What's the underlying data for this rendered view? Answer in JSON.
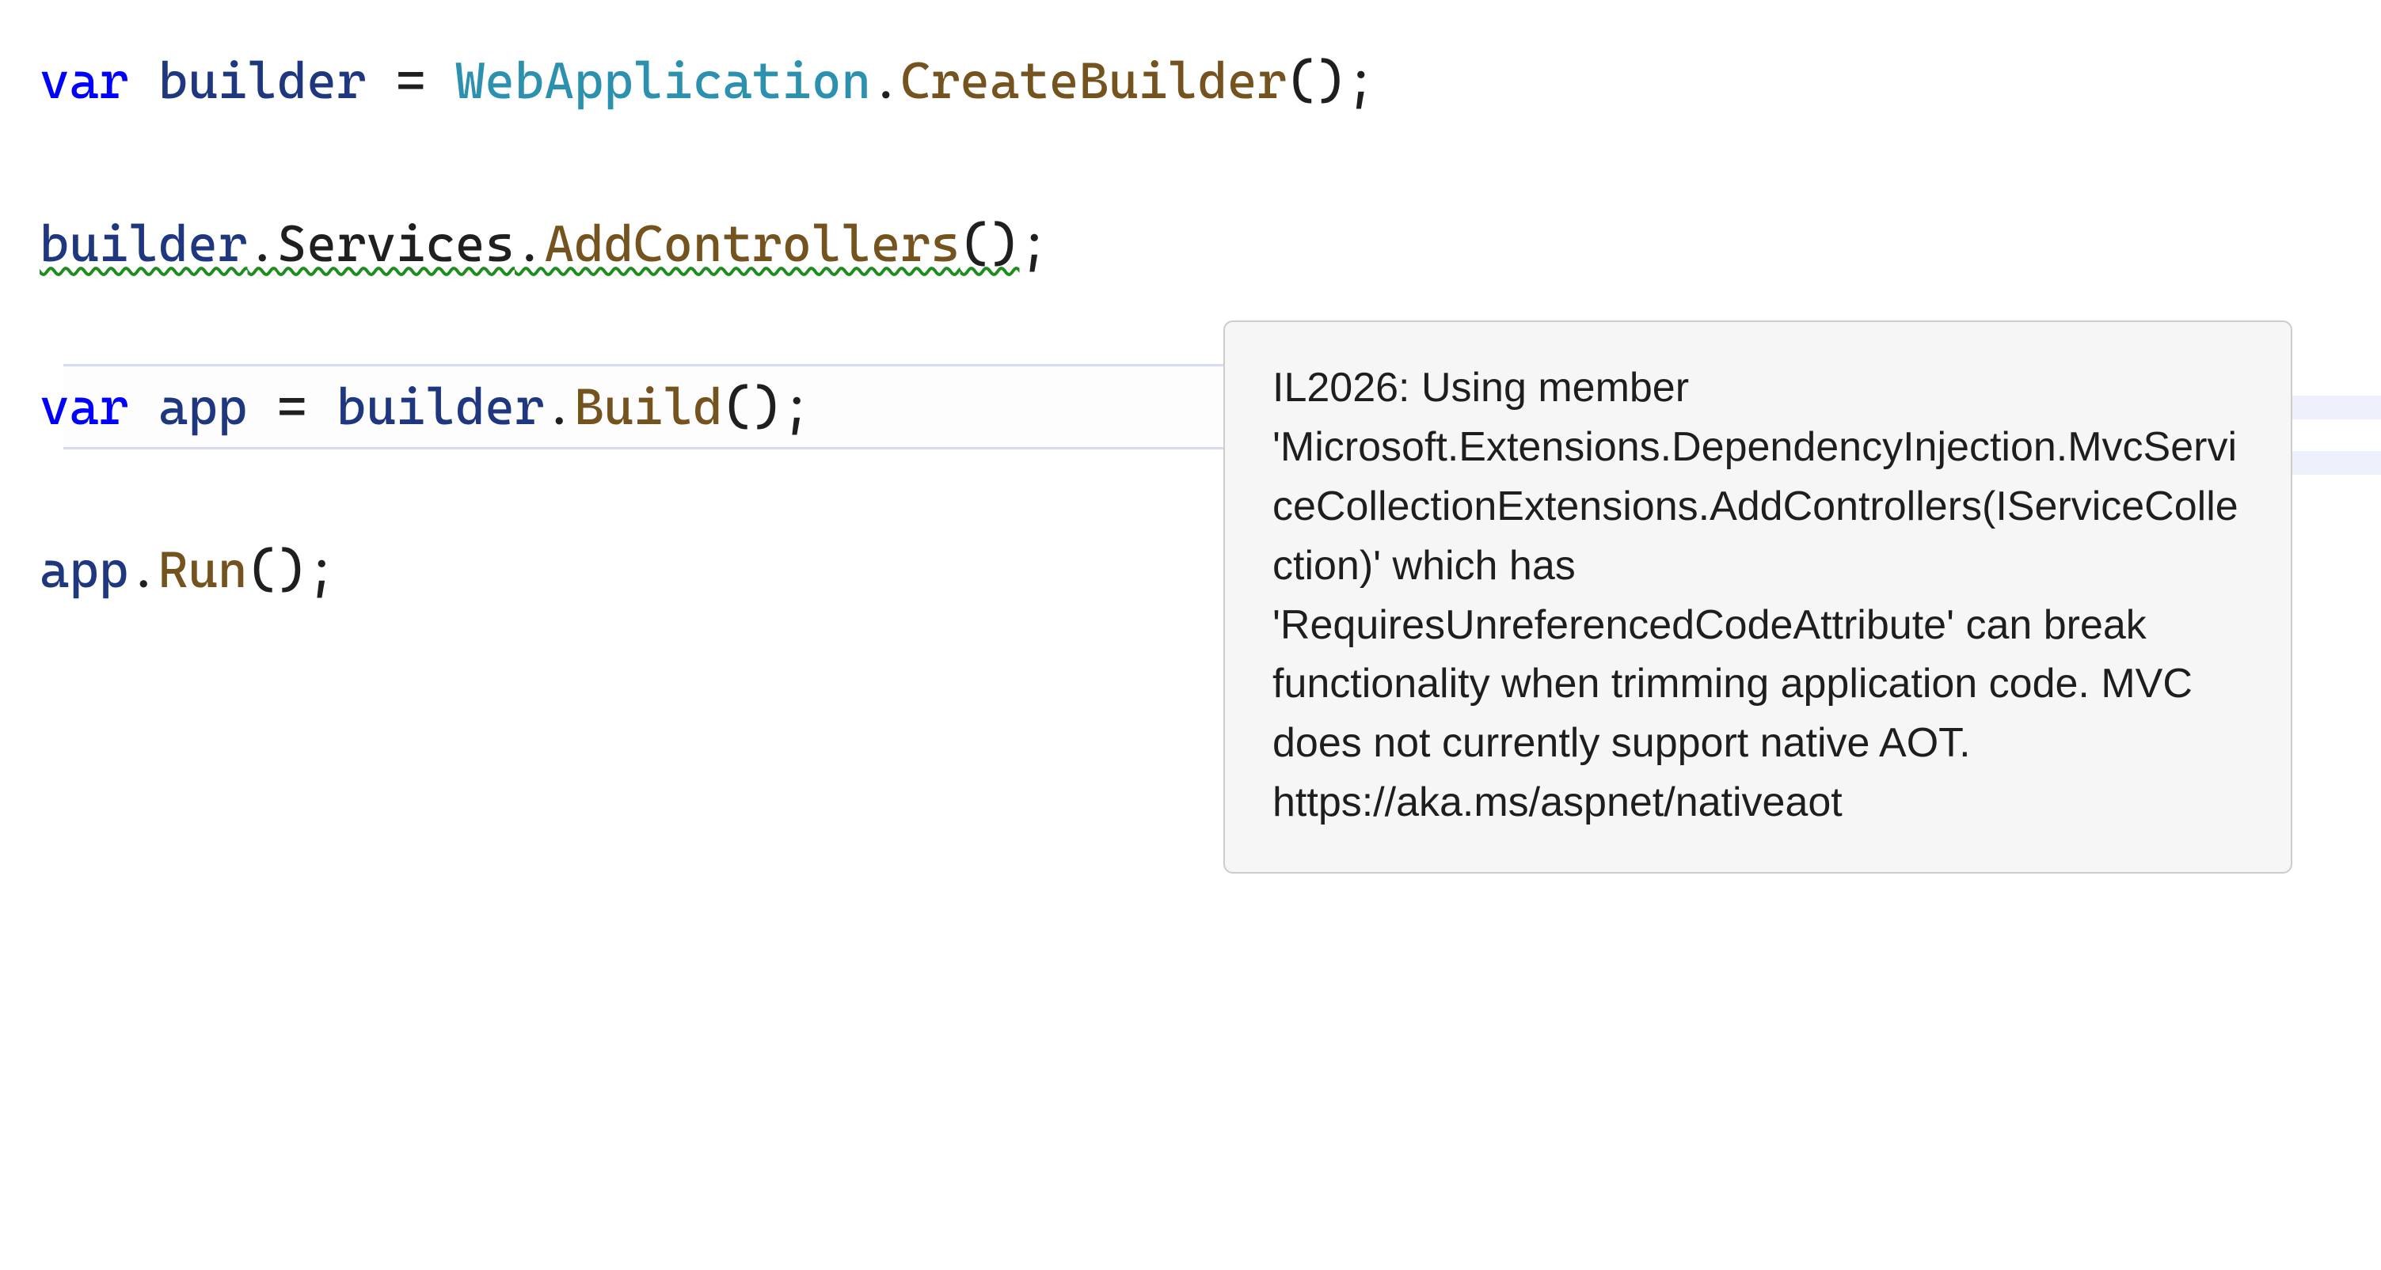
{
  "code": {
    "line1": {
      "kw_var": "var",
      "sp1": " ",
      "local_builder": "builder",
      "sp2": " ",
      "eq": "=",
      "sp3": " ",
      "type_WebApplication": "WebApplication",
      "dot1": ".",
      "method_CreateBuilder": "CreateBuilder",
      "parens_semi": "();"
    },
    "line2": {
      "local_builder": "builder",
      "dot1": ".",
      "prop_Services": "Services",
      "dot2": ".",
      "method_AddControllers": "AddControllers",
      "parens": "()",
      "semi": ";"
    },
    "line3": {
      "kw_var": "var",
      "sp1": " ",
      "local_app": "app",
      "sp2": " ",
      "eq": "=",
      "sp3": " ",
      "local_builder": "builder",
      "dot1": ".",
      "method_Build": "Build",
      "parens_semi": "();"
    },
    "line4": {
      "local_app": "app",
      "dot1": ".",
      "method_Run": "Run",
      "parens_semi": "();"
    }
  },
  "tooltip": {
    "text": "IL2026: Using member 'Microsoft.Extensions.DependencyInjection.MvcServiceCollectionExtensions.AddControllers(IServiceCollection)' which has 'RequiresUnreferencedCodeAttribute' can break functionality when trimming application code. MVC does not currently support native AOT. https://aka.ms/aspnet/nativeaot"
  },
  "colors": {
    "keyword": "#0000ff",
    "local": "#1f377f",
    "type": "#2b91af",
    "method": "#74531f",
    "squiggle": "#1e8c1e",
    "tooltip_bg": "#f6f6f6",
    "tooltip_border": "#cccccc"
  }
}
